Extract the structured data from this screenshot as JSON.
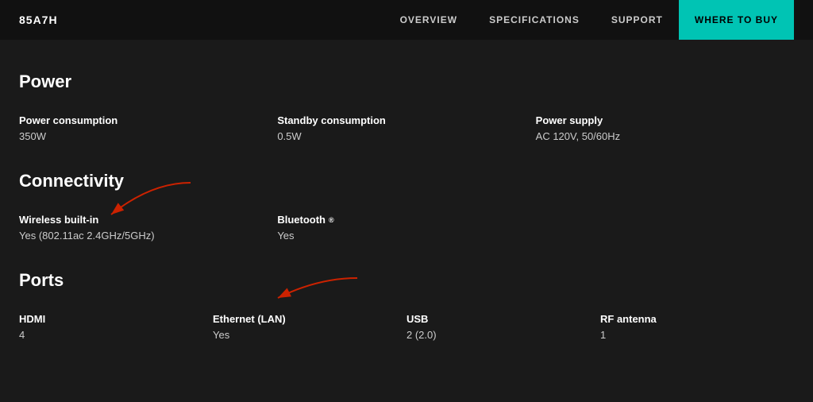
{
  "brand": "85A7H",
  "nav": {
    "links": [
      {
        "label": "OVERVIEW",
        "id": "overview"
      },
      {
        "label": "SPECIFICATIONS",
        "id": "specifications"
      },
      {
        "label": "SUPPORT",
        "id": "support"
      }
    ],
    "cta": "WHERE TO BUY"
  },
  "sections": {
    "power": {
      "title": "Power",
      "specs": [
        {
          "label": "Power consumption",
          "value": "350W"
        },
        {
          "label": "Standby consumption",
          "value": "0.5W"
        },
        {
          "label": "Power supply",
          "value": "AC 120V, 50/60Hz"
        }
      ]
    },
    "connectivity": {
      "title": "Connectivity",
      "specs": [
        {
          "label": "Wireless built-in",
          "value": "Yes (802.11ac 2.4GHz/5GHz)"
        },
        {
          "label": "Bluetooth",
          "trademark": "®",
          "value": "Yes"
        }
      ]
    },
    "ports": {
      "title": "Ports",
      "specs": [
        {
          "label": "HDMI",
          "value": "4"
        },
        {
          "label": "Ethernet (LAN)",
          "value": "Yes"
        },
        {
          "label": "USB",
          "value": "2 (2.0)"
        },
        {
          "label": "RF antenna",
          "value": "1"
        }
      ]
    }
  }
}
